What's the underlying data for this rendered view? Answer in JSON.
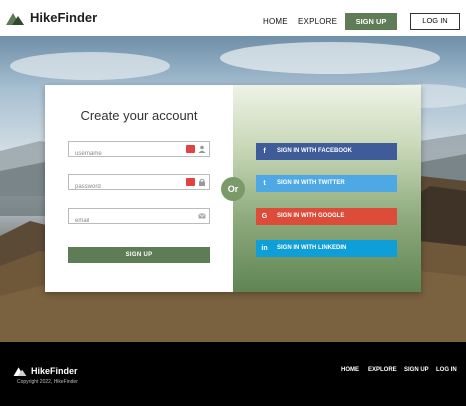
{
  "header": {
    "brand": "HikeFinder",
    "nav": {
      "home": "HOME",
      "explore": "EXPLORE"
    },
    "signup_label": "SIGN UP",
    "login_label": "LOG IN"
  },
  "form": {
    "title": "Create your account",
    "username_placeholder": "username",
    "password_placeholder": "password",
    "email_placeholder": "email",
    "submit_label": "SIGN UP",
    "divider": "Or"
  },
  "social": {
    "facebook": "SIGN IN WITH FACEBOOK",
    "twitter": "SIGN IN WITH TWITTER",
    "google": "SIGN IN WITH GOOGLE",
    "linkedin": "SIGN IN WITH LINKEDIN",
    "facebook_icon": "f",
    "twitter_icon": "t",
    "google_icon": "G",
    "linkedin_icon": "in"
  },
  "footer": {
    "brand": "HikeFinder",
    "copyright": "Copyright 2022, HikeFinder",
    "links": {
      "home": "HOME",
      "explore": "EXPLORE",
      "signup": "SIGN UP",
      "login": "LOG IN"
    }
  },
  "colors": {
    "accent": "#5e7c55",
    "facebook": "#3f5b99",
    "twitter": "#4ea8e6",
    "google": "#dd4b39",
    "linkedin": "#0e9ed8"
  }
}
